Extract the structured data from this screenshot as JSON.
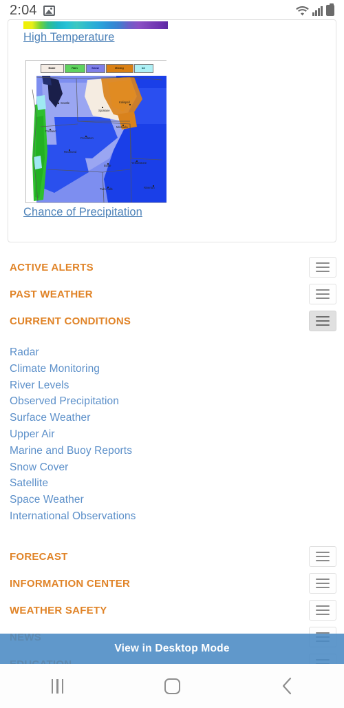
{
  "status_bar": {
    "time": "2:04",
    "icons": [
      "image-icon",
      "wifi-icon",
      "cellular-signal-icon",
      "battery-icon"
    ]
  },
  "card": {
    "high_temperature_link": "High Temperature",
    "chance_of_precipitation_link": "Chance of Precipitation",
    "precip_map": {
      "alt": "Pacific Northwest chance of precipitation map",
      "legend": [
        {
          "label": "None",
          "color": "#f4ece4"
        },
        {
          "label": "Rain",
          "color": "#5fd35f"
        },
        {
          "label": "Snow",
          "color": "#7f7fe8"
        },
        {
          "label": "Mixing",
          "color": "#d98014"
        },
        {
          "label": "Ice",
          "color": "#aef0f5"
        }
      ],
      "cities": [
        "Seattle",
        "Spokane",
        "Kalispell",
        "Portland",
        "Pendleton",
        "Missoula",
        "Redmond",
        "Boise",
        "Twin Falls",
        "Yellowstone",
        "Riverton"
      ]
    },
    "high_temp_map_gradient": [
      "#f2f000",
      "#6fd13a",
      "#1fb7c8",
      "#29a7da",
      "#8a4fc4",
      "#5a2aa0"
    ]
  },
  "sections": [
    {
      "title": "ACTIVE ALERTS",
      "expanded": false
    },
    {
      "title": "PAST WEATHER",
      "expanded": false
    },
    {
      "title": "CURRENT CONDITIONS",
      "expanded": true
    },
    {
      "title": "FORECAST",
      "expanded": false
    },
    {
      "title": "INFORMATION CENTER",
      "expanded": false
    },
    {
      "title": "WEATHER SAFETY",
      "expanded": false
    },
    {
      "title": "NEWS",
      "expanded": false
    },
    {
      "title": "EDUCATION",
      "expanded": false
    }
  ],
  "current_conditions_links": [
    "Radar",
    "Climate Monitoring",
    "River Levels",
    "Observed Precipitation",
    "Surface Weather",
    "Upper Air",
    "Marine and Buoy Reports",
    "Snow Cover",
    "Satellite",
    "Space Weather",
    "International Observations"
  ],
  "desktop_banner": {
    "label": "View in Desktop Mode"
  },
  "nav_bar": {
    "recents": "recents-icon",
    "home": "home-icon",
    "back": "back-icon"
  },
  "colors": {
    "section_heading": "#e08327",
    "link": "#5b8fc9",
    "banner": "#4a8ac4",
    "card_border": "#e2e2e2"
  }
}
